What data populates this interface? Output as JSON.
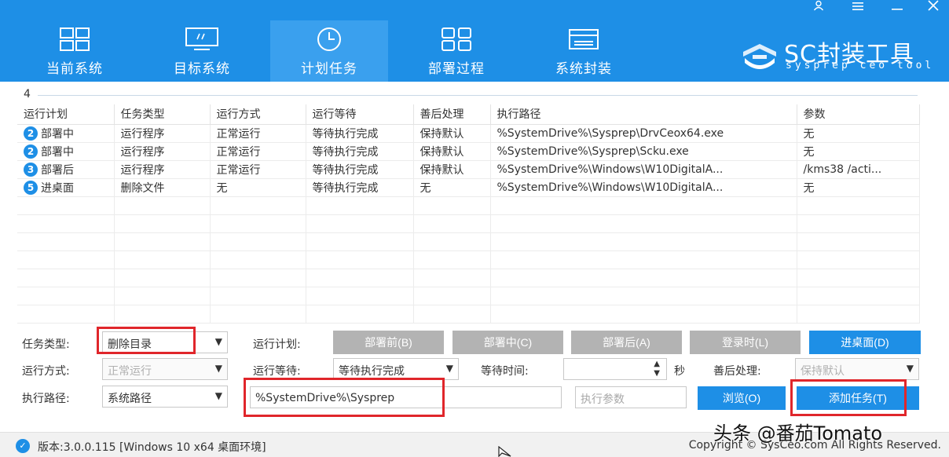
{
  "window": {
    "user_icon": "user-icon",
    "menu_icon": "menu-icon",
    "minimize_icon": "minimize-icon",
    "close_icon": "close-icon"
  },
  "nav": {
    "tabs": [
      {
        "label": "当前系统",
        "icon": "windows-icon"
      },
      {
        "label": "目标系统",
        "icon": "monitor-icon"
      },
      {
        "label": "计划任务",
        "icon": "clock-icon"
      },
      {
        "label": "部署过程",
        "icon": "grid-icon"
      },
      {
        "label": "系统封装",
        "icon": "drive-icon"
      }
    ],
    "active_index": 2
  },
  "logo": {
    "title": "SC封装工具",
    "subtitle": "sysprep ceo tool"
  },
  "group": {
    "number": "4"
  },
  "table": {
    "headers": [
      "运行计划",
      "任务类型",
      "运行方式",
      "运行等待",
      "善后处理",
      "执行路径",
      "参数"
    ],
    "rows": [
      {
        "badge": "2",
        "plan": "部署中",
        "type": "运行程序",
        "mode": "正常运行",
        "wait": "等待执行完成",
        "after": "保持默认",
        "path": "%SystemDrive%\\Sysprep\\DrvCeox64.exe",
        "param": "无"
      },
      {
        "badge": "2",
        "plan": "部署中",
        "type": "运行程序",
        "mode": "正常运行",
        "wait": "等待执行完成",
        "after": "保持默认",
        "path": "%SystemDrive%\\Sysprep\\Scku.exe",
        "param": "无"
      },
      {
        "badge": "3",
        "plan": "部署后",
        "type": "运行程序",
        "mode": "正常运行",
        "wait": "等待执行完成",
        "after": "保持默认",
        "path": "%SystemDrive%\\Windows\\W10DigitalA...",
        "param": "/kms38 /acti..."
      },
      {
        "badge": "5",
        "plan": "进桌面",
        "type": "删除文件",
        "mode": "无",
        "wait": "等待执行完成",
        "after": "无",
        "path": "%SystemDrive%\\Windows\\W10DigitalA...",
        "param": "无"
      }
    ]
  },
  "form": {
    "task_type_label": "任务类型:",
    "task_type_value": "删除目录",
    "run_plan_label": "运行计划:",
    "plan_buttons": [
      "部署前(B)",
      "部署中(C)",
      "部署后(A)",
      "登录时(L)",
      "进桌面(D)"
    ],
    "active_plan_index": 4,
    "run_mode_label": "运行方式:",
    "run_mode_value": "正常运行",
    "run_wait_label": "运行等待:",
    "run_wait_value": "等待执行完成",
    "wait_time_label": "等待时间:",
    "wait_time_unit": "秒",
    "after_label": "善后处理:",
    "after_value": "保持默认",
    "exec_path_label": "执行路径:",
    "exec_path_type": "系统路径",
    "exec_path_value": "%SystemDrive%\\Sysprep",
    "exec_param_placeholder": "执行参数",
    "browse_label": "浏览(O)",
    "add_task_label": "添加任务(T)"
  },
  "status": {
    "version": "版本:3.0.0.115 [Windows 10 x64 桌面环境]",
    "copyright": "Copyright © SysCeo.com All Rights Reserved."
  },
  "watermark": "头条 @番茄Tomato",
  "colors": {
    "header": "#1e8fe6",
    "active_tab": "#3aa0ee",
    "primary_button": "#1e8fe6",
    "disabled_button": "#b3b3b3",
    "highlight_box": "#e0262b"
  }
}
